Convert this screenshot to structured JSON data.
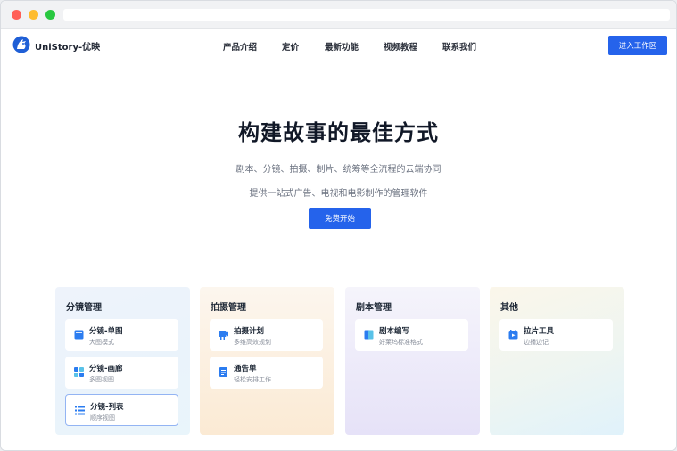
{
  "brand": {
    "name": "UniStory-优映"
  },
  "nav": {
    "items": [
      "产品介绍",
      "定价",
      "最新功能",
      "视频教程",
      "联系我们"
    ],
    "workspace_button": "进入工作区"
  },
  "hero": {
    "title": "构建故事的最佳方式",
    "subtitle_1": "剧本、分镜、拍摄、制片、统筹等全流程的云端协同",
    "subtitle_2": "提供一站式广告、电视和电影制作的管理软件",
    "start_button": "免费开始"
  },
  "cards": [
    {
      "title": "分镜管理",
      "items": [
        {
          "title": "分镜-单图",
          "subtitle": "大图模式",
          "icon": "single-image-icon"
        },
        {
          "title": "分镜-画廊",
          "subtitle": "多图视图",
          "icon": "gallery-grid-icon"
        },
        {
          "title": "分镜-列表",
          "subtitle": "顺序视图",
          "icon": "list-icon"
        }
      ]
    },
    {
      "title": "拍摄管理",
      "items": [
        {
          "title": "拍摄计划",
          "subtitle": "多维高效规划",
          "icon": "camera-plan-icon"
        },
        {
          "title": "通告单",
          "subtitle": "轻松安排工作",
          "icon": "call-sheet-icon"
        }
      ]
    },
    {
      "title": "剧本管理",
      "items": [
        {
          "title": "剧本编写",
          "subtitle": "好莱坞标准格式",
          "icon": "script-book-icon"
        }
      ]
    },
    {
      "title": "其他",
      "items": [
        {
          "title": "拉片工具",
          "subtitle": "边播边记",
          "icon": "film-analysis-icon"
        }
      ]
    }
  ],
  "colors": {
    "accent": "#2563eb",
    "title": "#111827",
    "muted": "#6b7280"
  }
}
